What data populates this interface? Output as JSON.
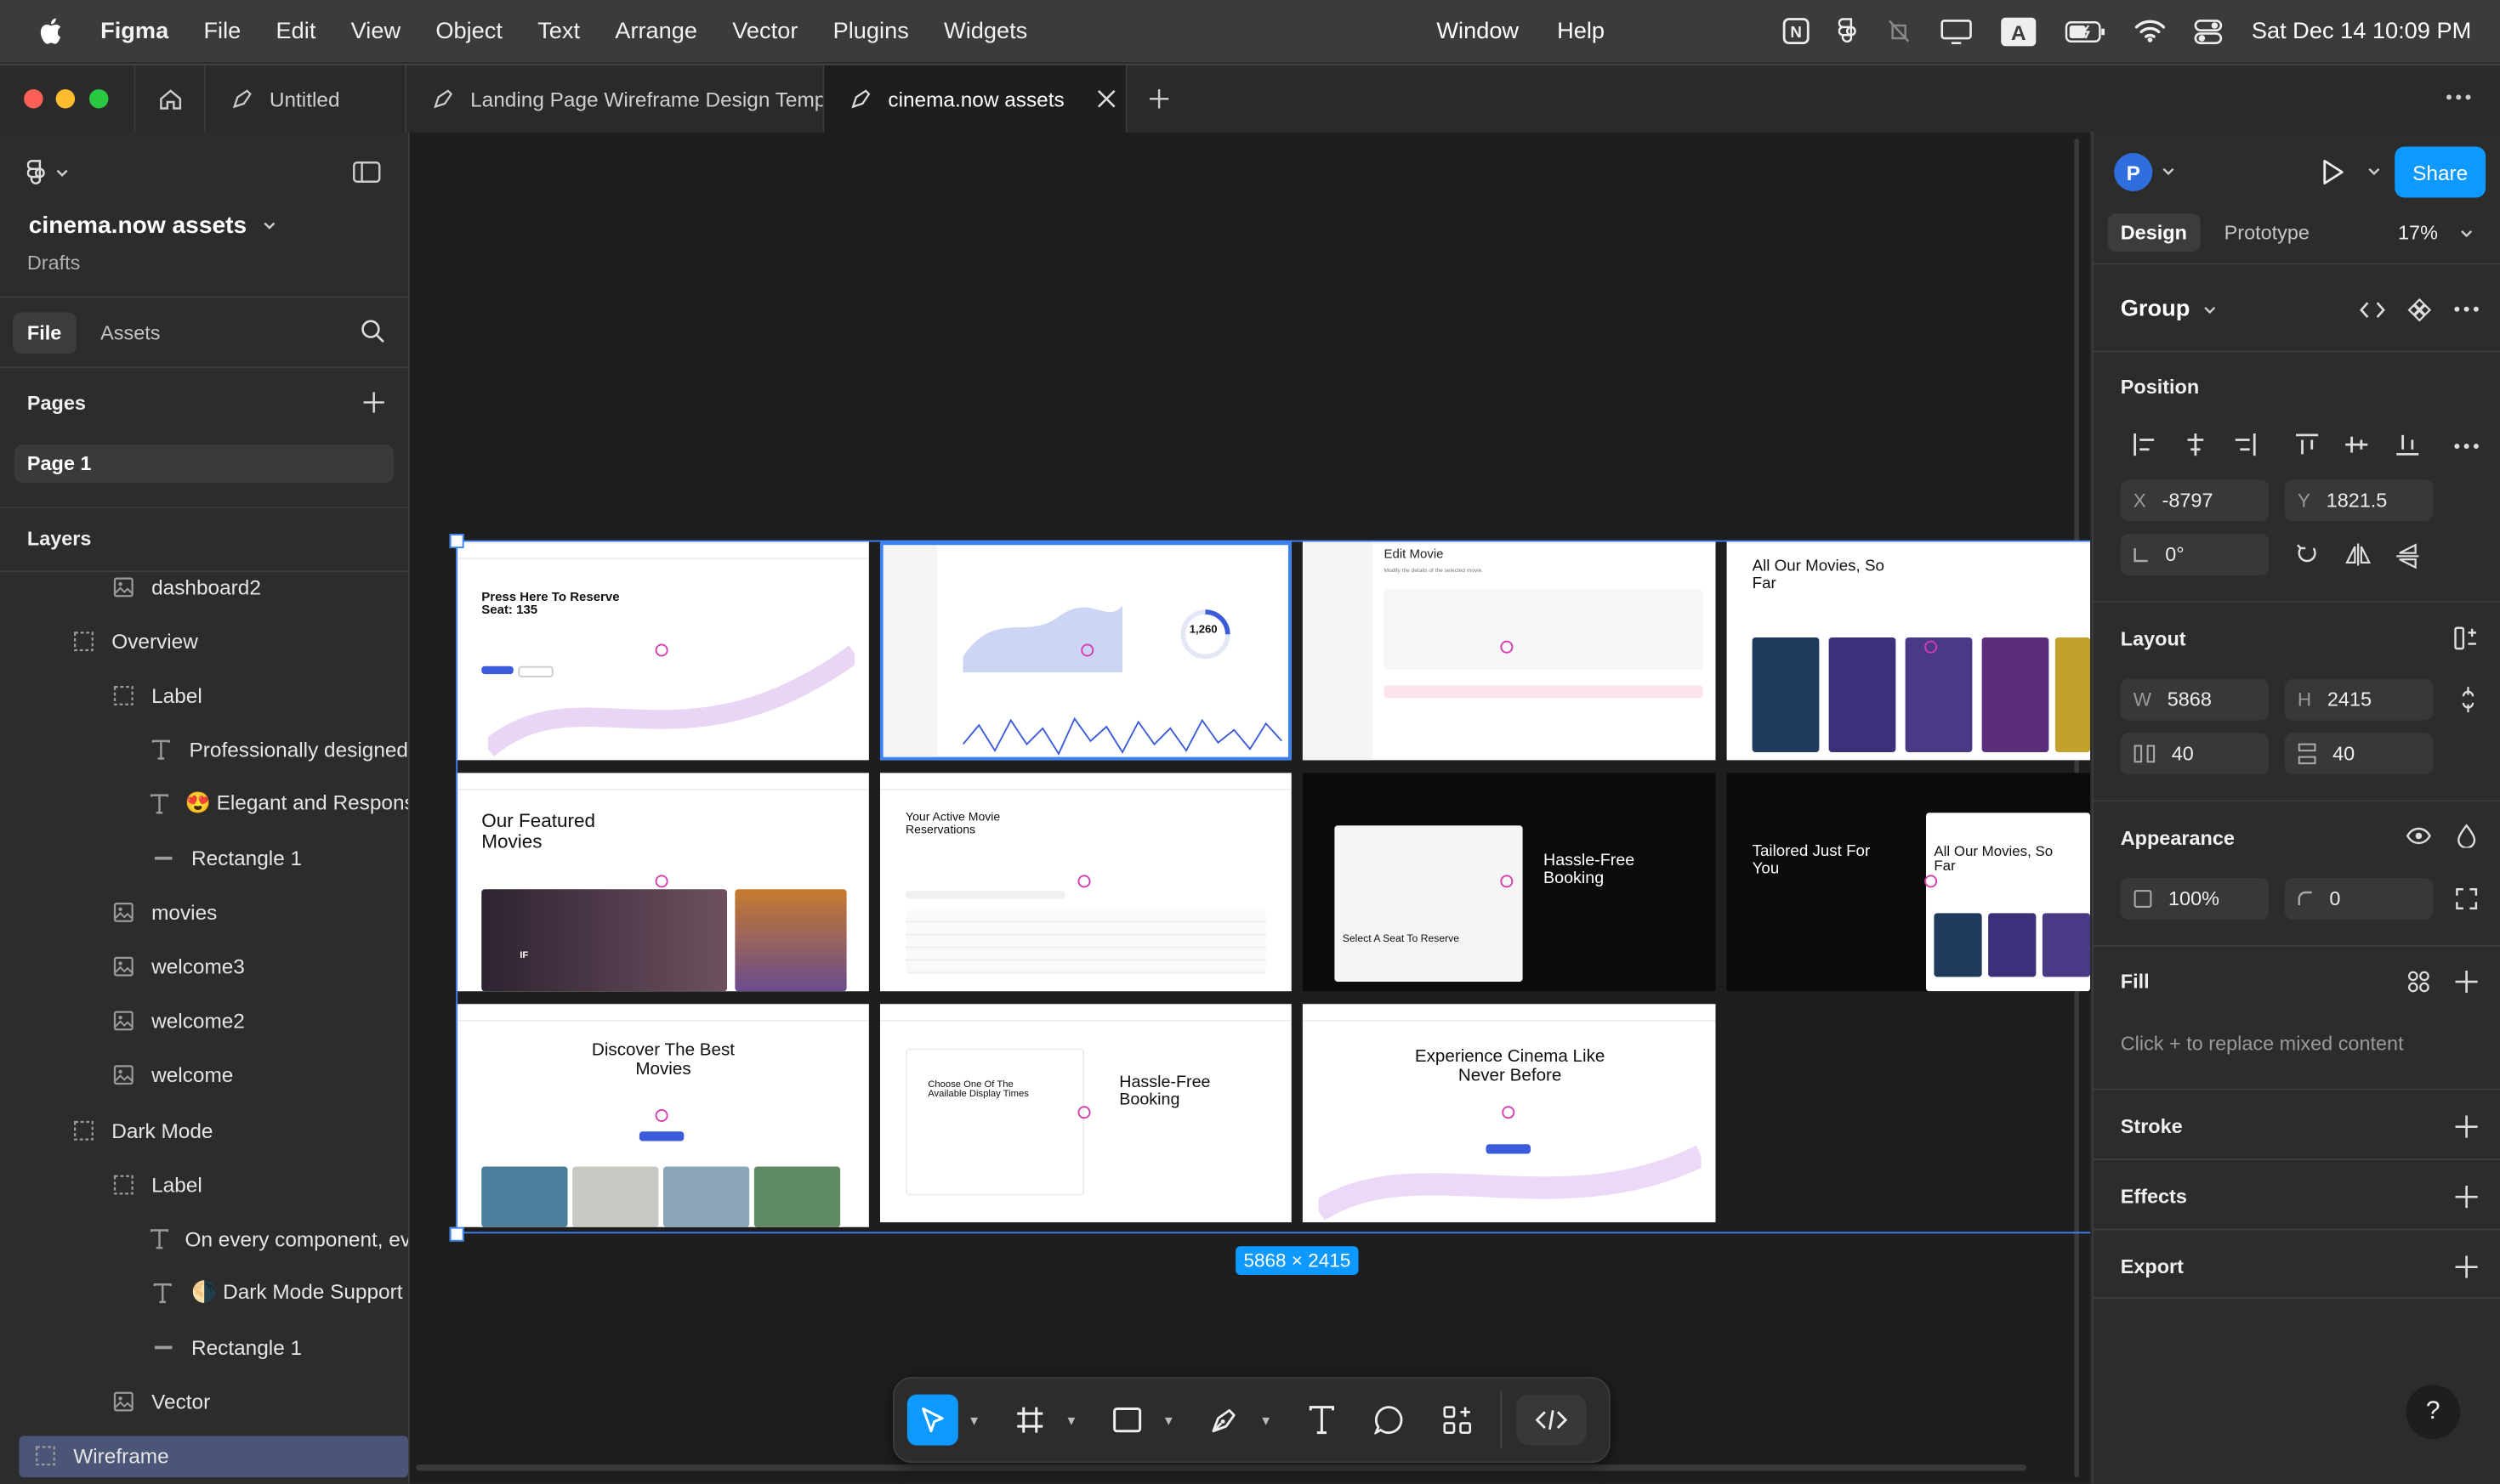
{
  "menubar": {
    "app": "Figma",
    "items": [
      "File",
      "Edit",
      "View",
      "Object",
      "Text",
      "Arrange",
      "Vector",
      "Plugins",
      "Widgets"
    ],
    "center_items": [
      "Window",
      "Help"
    ],
    "clock": "Sat Dec 14  10:09 PM"
  },
  "tabs": [
    {
      "label": "Untitled"
    },
    {
      "label": "Landing Page Wireframe Design Temp"
    },
    {
      "label": "cinema.now assets"
    }
  ],
  "file": {
    "name": "cinema.now assets",
    "location": "Drafts"
  },
  "left_tabs": {
    "file": "File",
    "assets": "Assets"
  },
  "pages": {
    "title": "Pages",
    "items": [
      "Page 1"
    ]
  },
  "layers": {
    "title": "Layers",
    "items": [
      {
        "name": "dashboard2",
        "type": "image",
        "indent": 2
      },
      {
        "name": "Overview",
        "type": "frame",
        "indent": 1
      },
      {
        "name": "Label",
        "type": "frame",
        "indent": 2
      },
      {
        "name": "Professionally designed",
        "type": "text",
        "indent": 3
      },
      {
        "name": "😍 Elegant and Responsi",
        "type": "text",
        "indent": 3
      },
      {
        "name": "Rectangle 1",
        "type": "rect",
        "indent": 3
      },
      {
        "name": "movies",
        "type": "image",
        "indent": 2
      },
      {
        "name": "welcome3",
        "type": "image",
        "indent": 2
      },
      {
        "name": "welcome2",
        "type": "image",
        "indent": 2
      },
      {
        "name": "welcome",
        "type": "image",
        "indent": 2
      },
      {
        "name": "Dark Mode",
        "type": "frame",
        "indent": 1
      },
      {
        "name": "Label",
        "type": "frame",
        "indent": 2
      },
      {
        "name": "On every component, ev",
        "type": "text",
        "indent": 3
      },
      {
        "name": "🌗 Dark Mode Support",
        "type": "text",
        "indent": 3
      },
      {
        "name": "Rectangle 1",
        "type": "rect",
        "indent": 3
      },
      {
        "name": "Vector",
        "type": "image",
        "indent": 2
      },
      {
        "name": "Wireframe",
        "type": "frame",
        "indent": 0,
        "selected": true
      }
    ]
  },
  "canvas": {
    "selection_size": "5868 × 2415",
    "frames": {
      "f1": {
        "title": "Press Here To Reserve Seat: 135"
      },
      "f2": {
        "title": "1,260"
      },
      "f3": {
        "title": "Edit Movie",
        "sub": "Modify the details of the selected movie."
      },
      "f4": {
        "title": "All Our Movies, So Far"
      },
      "f5": {
        "title": "Our Featured Movies",
        "tag": "IF"
      },
      "f6": {
        "title": "Your Active Movie Reservations"
      },
      "f7": {
        "title": "Hassle-Free Booking",
        "sub": "Select A Seat To Reserve"
      },
      "f8": {
        "title": "Tailored Just For You",
        "sub": "All Our Movies, So Far"
      },
      "f9": {
        "title": "Discover The Best Movies"
      },
      "f10": {
        "title": "Hassle-Free Booking",
        "sub": "Choose One Of The Available Display Times"
      },
      "f11": {
        "title": "Experience Cinema Like Never Before"
      }
    }
  },
  "right": {
    "avatar": "P",
    "share": "Share",
    "tabs": {
      "design": "Design",
      "prototype": "Prototype"
    },
    "zoom": "17%",
    "selection_type": "Group",
    "position": {
      "title": "Position",
      "x_label": "X",
      "x": "-8797",
      "y_label": "Y",
      "y": "1821.5",
      "rotation": "0°"
    },
    "layout": {
      "title": "Layout",
      "w_label": "W",
      "w": "5868",
      "h_label": "H",
      "h": "2415",
      "gap_x": "40",
      "gap_y": "40"
    },
    "appearance": {
      "title": "Appearance",
      "opacity": "100%",
      "radius": "0"
    },
    "fill": {
      "title": "Fill",
      "hint": "Click + to replace mixed content"
    },
    "stroke": {
      "title": "Stroke"
    },
    "effects": {
      "title": "Effects"
    },
    "export": {
      "title": "Export"
    }
  },
  "help": "?",
  "colors": {
    "accent": "#0d99ff",
    "selection": "#3b82f6",
    "ring": "#d43bb0"
  }
}
